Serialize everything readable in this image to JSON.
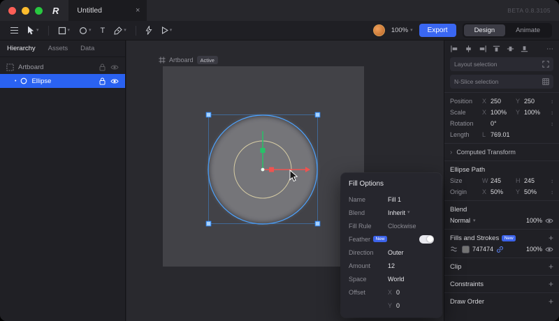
{
  "window": {
    "title": "Untitled",
    "beta": "BETA 0.8.3105"
  },
  "toolbar": {
    "zoom": "100%",
    "export_label": "Export",
    "design_label": "Design",
    "animate_label": "Animate"
  },
  "sidebar": {
    "tabs": [
      "Hierarchy",
      "Assets",
      "Data"
    ],
    "items": [
      {
        "label": "Artboard"
      },
      {
        "label": "Ellipse"
      }
    ]
  },
  "canvas": {
    "artboard_name": "Artboard",
    "active_badge": "Active"
  },
  "fill_options": {
    "title": "Fill Options",
    "name_label": "Name",
    "name_value": "Fill 1",
    "blend_label": "Blend",
    "blend_value": "Inherit",
    "fill_rule_label": "Fill Rule",
    "fill_rule_value": "Clockwise",
    "feather_label": "Feather",
    "feather_badge": "New",
    "direction_label": "Direction",
    "direction_value": "Outer",
    "amount_label": "Amount",
    "amount_value": "12",
    "space_label": "Space",
    "space_value": "World",
    "offset_label": "Offset",
    "offset_x_label": "X",
    "offset_x": "0",
    "offset_y_label": "Y",
    "offset_y": "0"
  },
  "inspector": {
    "layout_selection": "Layout selection",
    "nslice_selection": "N-Slice selection",
    "position_label": "Position",
    "position_x_label": "X",
    "position_x": "250",
    "position_y_label": "Y",
    "position_y": "250",
    "scale_label": "Scale",
    "scale_x_label": "X",
    "scale_x": "100%",
    "scale_y_label": "Y",
    "scale_y": "100%",
    "rotation_label": "Rotation",
    "rotation_value": "0°",
    "length_label": "Length",
    "length_unit": "L",
    "length_value": "769.01",
    "computed_transform": "Computed Transform",
    "ellipse_path": "Ellipse Path",
    "size_label": "Size",
    "size_w_label": "W",
    "size_w": "245",
    "size_h_label": "H",
    "size_h": "245",
    "origin_label": "Origin",
    "origin_x_label": "X",
    "origin_x": "50%",
    "origin_y_label": "Y",
    "origin_y": "50%",
    "blend_header": "Blend",
    "blend_mode": "Normal",
    "blend_opacity": "100%",
    "fills_header": "Fills and Strokes",
    "fills_badge": "New",
    "fill_hex": "747474",
    "fill_opacity": "100%",
    "clip_header": "Clip",
    "constraints_header": "Constraints",
    "draw_order_header": "Draw Order"
  },
  "icons": {
    "logo": "R",
    "close": "×",
    "chevron_down": "▾",
    "chevron_right": "›",
    "overflow": "⋯",
    "plus": "+",
    "stepper": "↕",
    "dot": "•",
    "text_tool": "T"
  },
  "colors": {
    "accent": "#3a67f2",
    "selection": "#4da3ff",
    "fill_gray": "#747474",
    "artboard": "#424247"
  }
}
